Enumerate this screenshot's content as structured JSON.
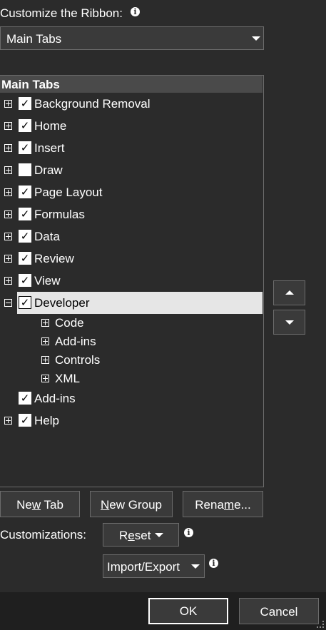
{
  "header": {
    "label": "Customize the Ribbon:",
    "info_icon": "info-icon"
  },
  "ribbon_dropdown": {
    "value": "Main Tabs"
  },
  "tree": {
    "header": "Main Tabs",
    "items": [
      {
        "label": "Background Removal",
        "checked": true,
        "expander": "plus"
      },
      {
        "label": "Home",
        "checked": true,
        "expander": "plus"
      },
      {
        "label": "Insert",
        "checked": true,
        "expander": "plus"
      },
      {
        "label": "Draw",
        "checked": false,
        "expander": "plus"
      },
      {
        "label": "Page Layout",
        "checked": true,
        "expander": "plus"
      },
      {
        "label": "Formulas",
        "checked": true,
        "expander": "plus"
      },
      {
        "label": "Data",
        "checked": true,
        "expander": "plus"
      },
      {
        "label": "Review",
        "checked": true,
        "expander": "plus"
      },
      {
        "label": "View",
        "checked": true,
        "expander": "plus"
      },
      {
        "label": "Developer",
        "checked": true,
        "expander": "minus",
        "selected": true
      },
      {
        "label": "Code",
        "child": true,
        "expander": "plus"
      },
      {
        "label": "Add-ins",
        "child": true,
        "expander": "plus"
      },
      {
        "label": "Controls",
        "child": true,
        "expander": "plus"
      },
      {
        "label": "XML",
        "child": true,
        "expander": "plus"
      },
      {
        "label": "Add-ins",
        "checked": true,
        "expander": "none"
      },
      {
        "label": "Help",
        "checked": true,
        "expander": "plus"
      }
    ]
  },
  "buttons": {
    "new_tab": {
      "pre": "Ne",
      "u": "w",
      "post": " Tab"
    },
    "new_group": {
      "pre": "",
      "u": "N",
      "post": "ew Group"
    },
    "rename": {
      "pre": "Rena",
      "u": "m",
      "post": "e..."
    },
    "customizations_label": "Customizations:",
    "reset": {
      "pre": "R",
      "u": "e",
      "post": "set"
    },
    "import_export": "Import/Export",
    "ok": "OK",
    "cancel": "Cancel"
  }
}
